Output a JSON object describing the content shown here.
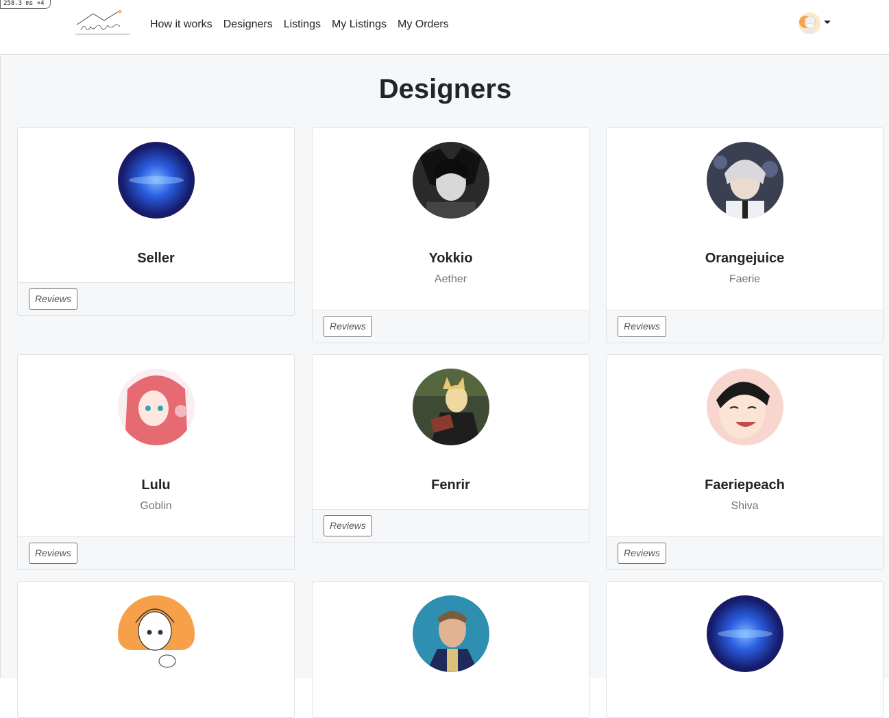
{
  "timing": "258.3 ms ×4",
  "nav": {
    "links": [
      "How it works",
      "Designers",
      "Listings",
      "My Listings",
      "My Orders"
    ]
  },
  "page": {
    "title": "Designers"
  },
  "reviews_label": "Reviews",
  "designers": [
    {
      "name": "Seller",
      "subtitle": "",
      "avatar": "galaxy-avatar"
    },
    {
      "name": "Yokkio",
      "subtitle": "Aether",
      "avatar": "grayscale-character-avatar"
    },
    {
      "name": "Orangejuice",
      "subtitle": "Faerie",
      "avatar": "white-haired-character-avatar"
    },
    {
      "name": "Lulu",
      "subtitle": "Goblin",
      "avatar": "pink-haired-girl-avatar"
    },
    {
      "name": "Fenrir",
      "subtitle": "",
      "avatar": "blonde-catboy-avatar"
    },
    {
      "name": "Faeriepeach",
      "subtitle": "Shiva",
      "avatar": "laughing-man-avatar"
    },
    {
      "name": "",
      "subtitle": "",
      "avatar": "sketch-girl-avatar"
    },
    {
      "name": "",
      "subtitle": "",
      "avatar": "blue-coat-man-avatar"
    },
    {
      "name": "",
      "subtitle": "",
      "avatar": "galaxy-avatar"
    }
  ]
}
